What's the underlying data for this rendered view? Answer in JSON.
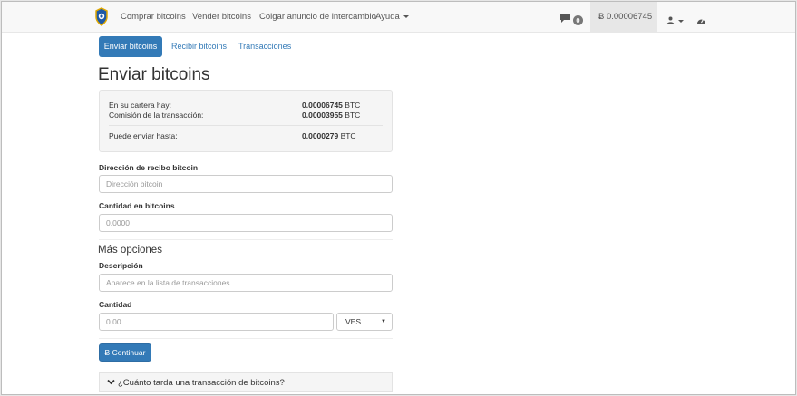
{
  "navbar": {
    "links": [
      "Comprar bitcoins",
      "Vender bitcoins",
      "Colgar anuncio de intercambio",
      "Ayuda"
    ],
    "notifications_count": "0",
    "balance": "Ƀ 0.00006745"
  },
  "tabs": {
    "send": "Enviar bitcoins",
    "receive": "Recibir bitcoins",
    "transactions": "Transacciones"
  },
  "page_title": "Enviar bitcoins",
  "summary": {
    "wallet_label": "En su cartera hay:",
    "wallet_amount": "0.00006745",
    "fee_label": "Comisión de la transacción:",
    "fee_amount": "0.00003955",
    "max_label": "Puede enviar hasta:",
    "max_amount": "0.0000279",
    "unit": "BTC"
  },
  "form": {
    "address_label": "Dirección de recibo bitcoin",
    "address_placeholder": "Dirección bitcoin",
    "amount_label": "Cantidad en bitcoins",
    "amount_placeholder": "0.0000",
    "more_options": "Más opciones",
    "description_label": "Descripción",
    "description_placeholder": "Aparece en la lista de transacciones",
    "fiat_label": "Cantidad",
    "fiat_placeholder": "0.00",
    "currency": "VES",
    "submit": "Ƀ Continuar"
  },
  "faq": {
    "question": "¿Cuánto tarda una transacción de bitcoins?"
  },
  "colors": {
    "primary": "#337ab7",
    "navbar_bg": "#f8f8f8",
    "well_bg": "#f5f5f5"
  }
}
